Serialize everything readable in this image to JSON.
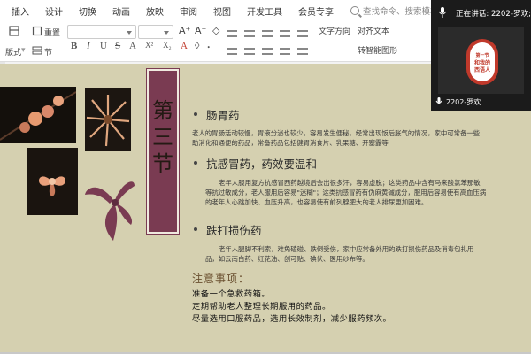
{
  "menu": {
    "tabs": [
      "插入",
      "设计",
      "切换",
      "动画",
      "放映",
      "审阅",
      "视图",
      "开发工具",
      "会员专享"
    ],
    "search_placeholder": "查找命令、搜索模板"
  },
  "toolbar": {
    "reset_label": "重置",
    "layout_label": "版式",
    "section_label": "节",
    "text_direction_label": "文字方向",
    "align_text_label": "对齐文本",
    "smartart_label": "转智能图形"
  },
  "meeting": {
    "speaking_label": "正在讲话: 2202-罗欢;",
    "participant_name": "2202-罗欢",
    "avatar_text_top": "第一节",
    "avatar_text_main": "和我的",
    "avatar_text_bottom": "西语人"
  },
  "slide": {
    "chapter_chars": [
      "第",
      "三",
      "节"
    ],
    "sections": [
      {
        "title": "肠胃药",
        "body": "老人的胃肠活动较慢，胃液分泌也较少，容易发生便秘，经常出现饭后胀气的情况，家中可常备一些助消化和通便的药品，常备药品包括健胃消食片、乳果糖、开塞露等"
      },
      {
        "title": "抗感冒药，药效要温和",
        "body": "老年人服用复方抗感冒西药越境后会出很多汗，容易虚脱；这类药品中含有马来酸氯苯那敏等抗过敏成分，老人服用后容易\"迷糊\"；这类抗感冒药有伪麻黄碱成分，服用后容易使有高血压病的老年人心跳加快、血压升高，也容易使有前列腺肥大的老人排尿更加困难。"
      },
      {
        "title": "跌打损伤药",
        "body": "老年人腿脚不利索，难免磕碰、跌倒受伤，家中应常备外用的跌打损伤药品及消毒包扎用品，如云南白药、红花油、创可贴、碘伏、医用纱布等。"
      }
    ],
    "notes_title": "注意事项：",
    "notes": [
      "准备一个急救药箱。",
      "定期帮助老人整理长期服用的药品。",
      "尽量选用口服药品，选用长效制剂，减少服药频次。"
    ]
  }
}
